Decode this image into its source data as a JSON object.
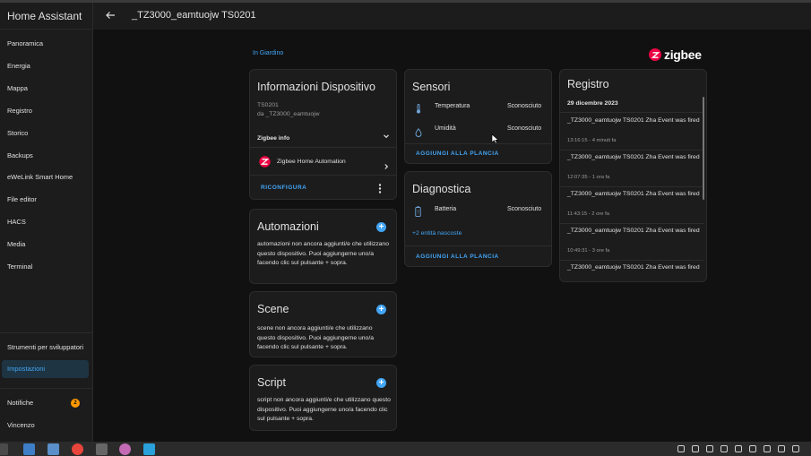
{
  "sidebar": {
    "brand": "Home Assistant",
    "items": [
      {
        "label": "Panoramica"
      },
      {
        "label": "Energia"
      },
      {
        "label": "Mappa"
      },
      {
        "label": "Registro"
      },
      {
        "label": "Storico"
      },
      {
        "label": "Backups"
      },
      {
        "label": "eWeLink Smart Home"
      },
      {
        "label": "File editor"
      },
      {
        "label": "HACS"
      },
      {
        "label": "Media"
      },
      {
        "label": "Terminal"
      }
    ],
    "dev_tools": "Strumenti per sviluppatori",
    "settings": "Impostazioni",
    "notifications": "Notifiche",
    "notifications_badge": "2",
    "user": "Vincenzo"
  },
  "header": {
    "title": "_TZ3000_eamtuojw TS0201"
  },
  "breadcrumb": "In Giardino",
  "brand_logo": "zigbee",
  "device_info": {
    "title": "Informazioni Dispositivo",
    "model": "TS0201",
    "manufacturer": "da _TZ3000_eamtuojw",
    "zigbee_info": "Zigbee info",
    "integration": "Zigbee Home Automation",
    "reconfigure": "RICONFIGURA"
  },
  "automations": {
    "title": "Automazioni",
    "text": "automazioni non ancora aggiunti/e che utilizzano questo dispositivo. Puoi aggiungerne uno/a facendo clic sul pulsante + sopra."
  },
  "scenes": {
    "title": "Scene",
    "text": "scene non ancora aggiunti/e che utilizzano questo dispositivo. Puoi aggiungerne uno/a facendo clic sul pulsante + sopra."
  },
  "scripts": {
    "title": "Script",
    "text": "script non ancora aggiunti/e che utilizzano questo dispositivo. Puoi aggiungerne uno/a facendo clic sul pulsante + sopra."
  },
  "sensors": {
    "title": "Sensori",
    "rows": [
      {
        "name": "Temperatura",
        "state": "Sconosciuto",
        "icon": "thermometer-icon"
      },
      {
        "name": "Umidità",
        "state": "Sconosciuto",
        "icon": "water-percent-icon"
      }
    ],
    "add": "AGGIUNGI ALLA PLANCIA"
  },
  "diagnostics": {
    "title": "Diagnostica",
    "rows": [
      {
        "name": "Batteria",
        "state": "Sconosciuto",
        "icon": "battery-icon"
      }
    ],
    "hidden": "+2 entità nascoste",
    "add": "AGGIUNGI ALLA PLANCIA"
  },
  "logbook": {
    "title": "Registro",
    "date": "29 dicembre 2023",
    "entries": [
      {
        "msg": "_TZ3000_eamtuojw TS0201 Zha Event was fired",
        "time": "13:16:15 - 4 minuti fa"
      },
      {
        "msg": "_TZ3000_eamtuojw TS0201 Zha Event was fired",
        "time": "12:07:35 - 1 ora fa"
      },
      {
        "msg": "_TZ3000_eamtuojw TS0201 Zha Event was fired",
        "time": "11:43:15 - 2 ore fa"
      },
      {
        "msg": "_TZ3000_eamtuojw TS0201 Zha Event was fired",
        "time": "10:49:31 - 3 ore fa"
      },
      {
        "msg": "_TZ3000_eamtuojw TS0201 Zha Event was fired",
        "time": ""
      }
    ]
  },
  "colors": {
    "accent": "#42a5f5",
    "zigbee": "#eb0443",
    "badge": "#ff9800"
  }
}
